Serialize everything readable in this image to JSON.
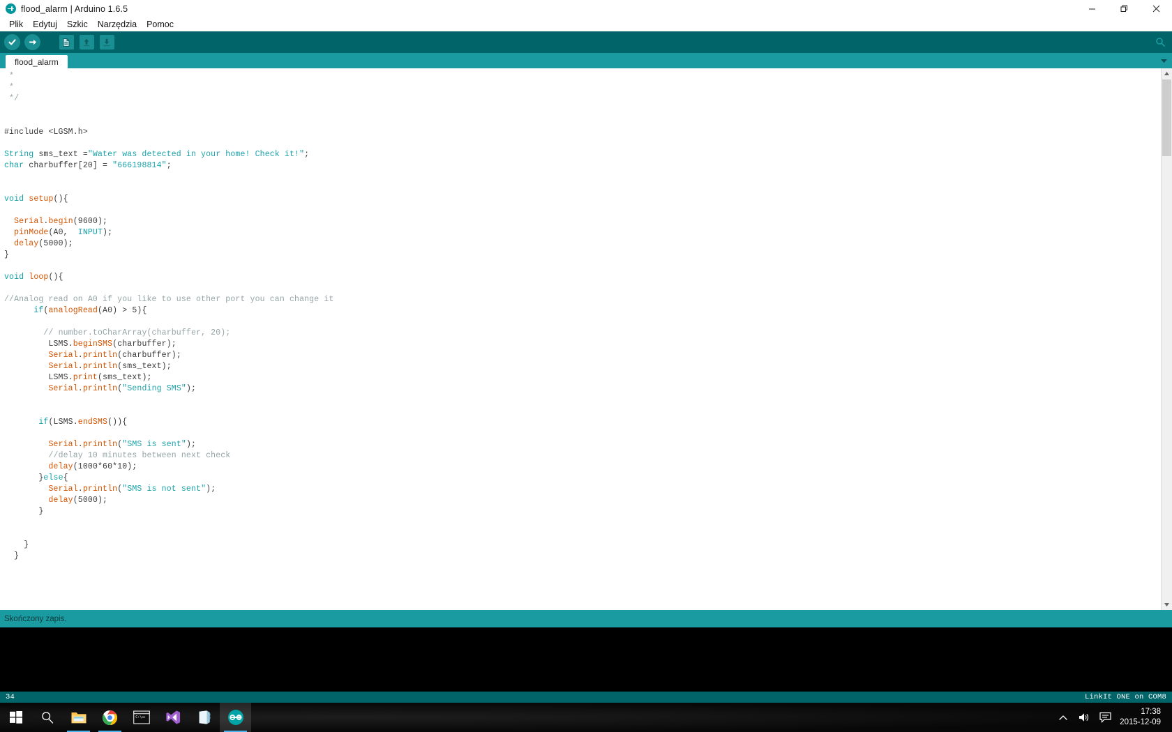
{
  "window": {
    "title": "flood_alarm | Arduino 1.6.5",
    "logo_icon": "arduino-logo-icon",
    "minimize_icon": "minimize-icon",
    "maximize_icon": "restore-icon",
    "close_icon": "close-icon"
  },
  "menubar": {
    "items": [
      {
        "label": "Plik"
      },
      {
        "label": "Edytuj"
      },
      {
        "label": "Szkic"
      },
      {
        "label": "Narzędzia"
      },
      {
        "label": "Pomoc"
      }
    ]
  },
  "toolbar": {
    "verify_icon": "check-icon",
    "upload_icon": "arrow-right-icon",
    "new_icon": "new-file-icon",
    "open_icon": "open-folder-up-arrow-icon",
    "save_icon": "save-down-arrow-icon",
    "serial_monitor_icon": "magnifier-icon"
  },
  "tabs": {
    "active": "flood_alarm",
    "items": [
      {
        "label": "flood_alarm"
      }
    ],
    "menu_icon": "chevron-down-icon"
  },
  "editor": {
    "lines": [
      [
        {
          "t": " *",
          "c": "cmt"
        }
      ],
      [
        {
          "t": " *",
          "c": "cmt"
        }
      ],
      [
        {
          "t": " */",
          "c": "cmt"
        }
      ],
      [
        {
          "t": "",
          "c": "plain"
        }
      ],
      [
        {
          "t": "",
          "c": "plain"
        }
      ],
      [
        {
          "t": "#include <LGSM.h>",
          "c": "plain"
        }
      ],
      [
        {
          "t": "",
          "c": "plain"
        }
      ],
      [
        {
          "t": "String",
          "c": "kw"
        },
        {
          "t": " sms_text =",
          "c": "plain"
        },
        {
          "t": "\"Water was detected in your home! Check it!\"",
          "c": "str"
        },
        {
          "t": ";",
          "c": "plain"
        }
      ],
      [
        {
          "t": "char",
          "c": "kw"
        },
        {
          "t": " charbuffer[20] = ",
          "c": "plain"
        },
        {
          "t": "\"666198814\"",
          "c": "str"
        },
        {
          "t": ";",
          "c": "plain"
        }
      ],
      [
        {
          "t": "",
          "c": "plain"
        }
      ],
      [
        {
          "t": "",
          "c": "plain"
        }
      ],
      [
        {
          "t": "void",
          "c": "kw"
        },
        {
          "t": " ",
          "c": "plain"
        },
        {
          "t": "setup",
          "c": "fn"
        },
        {
          "t": "(){",
          "c": "plain"
        }
      ],
      [
        {
          "t": "",
          "c": "plain"
        }
      ],
      [
        {
          "t": "  ",
          "c": "plain"
        },
        {
          "t": "Serial",
          "c": "fn"
        },
        {
          "t": ".",
          "c": "plain"
        },
        {
          "t": "begin",
          "c": "fn"
        },
        {
          "t": "(9600);",
          "c": "plain"
        }
      ],
      [
        {
          "t": "  ",
          "c": "plain"
        },
        {
          "t": "pinMode",
          "c": "fn"
        },
        {
          "t": "(A0,  ",
          "c": "plain"
        },
        {
          "t": "INPUT",
          "c": "kw"
        },
        {
          "t": ");",
          "c": "plain"
        }
      ],
      [
        {
          "t": "  ",
          "c": "plain"
        },
        {
          "t": "delay",
          "c": "fn"
        },
        {
          "t": "(5000);",
          "c": "plain"
        }
      ],
      [
        {
          "t": "}",
          "c": "plain"
        }
      ],
      [
        {
          "t": "",
          "c": "plain"
        }
      ],
      [
        {
          "t": "void",
          "c": "kw"
        },
        {
          "t": " ",
          "c": "plain"
        },
        {
          "t": "loop",
          "c": "fn"
        },
        {
          "t": "(){",
          "c": "plain"
        }
      ],
      [
        {
          "t": "",
          "c": "plain"
        }
      ],
      [
        {
          "t": "//Analog read on A0 if you like to use other port you can change it",
          "c": "cmt"
        }
      ],
      [
        {
          "t": "      ",
          "c": "plain"
        },
        {
          "t": "if",
          "c": "kw"
        },
        {
          "t": "(",
          "c": "plain"
        },
        {
          "t": "analogRead",
          "c": "fn"
        },
        {
          "t": "(A0) > 5){",
          "c": "plain"
        }
      ],
      [
        {
          "t": "",
          "c": "plain"
        }
      ],
      [
        {
          "t": "        ",
          "c": "plain"
        },
        {
          "t": "// number.toCharArray(charbuffer, 20);",
          "c": "cmt"
        }
      ],
      [
        {
          "t": "         LSMS.",
          "c": "plain"
        },
        {
          "t": "beginSMS",
          "c": "fn"
        },
        {
          "t": "(charbuffer);",
          "c": "plain"
        }
      ],
      [
        {
          "t": "         ",
          "c": "plain"
        },
        {
          "t": "Serial",
          "c": "fn"
        },
        {
          "t": ".",
          "c": "plain"
        },
        {
          "t": "println",
          "c": "fn"
        },
        {
          "t": "(charbuffer);",
          "c": "plain"
        }
      ],
      [
        {
          "t": "         ",
          "c": "plain"
        },
        {
          "t": "Serial",
          "c": "fn"
        },
        {
          "t": ".",
          "c": "plain"
        },
        {
          "t": "println",
          "c": "fn"
        },
        {
          "t": "(sms_text);",
          "c": "plain"
        }
      ],
      [
        {
          "t": "         LSMS.",
          "c": "plain"
        },
        {
          "t": "print",
          "c": "fn"
        },
        {
          "t": "(sms_text);",
          "c": "plain"
        }
      ],
      [
        {
          "t": "         ",
          "c": "plain"
        },
        {
          "t": "Serial",
          "c": "fn"
        },
        {
          "t": ".",
          "c": "plain"
        },
        {
          "t": "println",
          "c": "fn"
        },
        {
          "t": "(",
          "c": "plain"
        },
        {
          "t": "\"Sending SMS\"",
          "c": "str"
        },
        {
          "t": ");",
          "c": "plain"
        }
      ],
      [
        {
          "t": "",
          "c": "plain"
        }
      ],
      [
        {
          "t": "",
          "c": "plain"
        }
      ],
      [
        {
          "t": "       ",
          "c": "plain"
        },
        {
          "t": "if",
          "c": "kw"
        },
        {
          "t": "(LSMS.",
          "c": "plain"
        },
        {
          "t": "endSMS",
          "c": "fn"
        },
        {
          "t": "()){",
          "c": "plain"
        }
      ],
      [
        {
          "t": "",
          "c": "plain"
        }
      ],
      [
        {
          "t": "         ",
          "c": "plain"
        },
        {
          "t": "Serial",
          "c": "fn"
        },
        {
          "t": ".",
          "c": "plain"
        },
        {
          "t": "println",
          "c": "fn"
        },
        {
          "t": "(",
          "c": "plain"
        },
        {
          "t": "\"SMS is sent\"",
          "c": "str"
        },
        {
          "t": ");",
          "c": "plain"
        }
      ],
      [
        {
          "t": "         ",
          "c": "plain"
        },
        {
          "t": "//delay 10 minutes between next check",
          "c": "cmt"
        }
      ],
      [
        {
          "t": "         ",
          "c": "plain"
        },
        {
          "t": "delay",
          "c": "fn"
        },
        {
          "t": "(1000*60*10);",
          "c": "plain"
        }
      ],
      [
        {
          "t": "       }",
          "c": "plain"
        },
        {
          "t": "else",
          "c": "kw"
        },
        {
          "t": "{",
          "c": "plain"
        }
      ],
      [
        {
          "t": "         ",
          "c": "plain"
        },
        {
          "t": "Serial",
          "c": "fn"
        },
        {
          "t": ".",
          "c": "plain"
        },
        {
          "t": "println",
          "c": "fn"
        },
        {
          "t": "(",
          "c": "plain"
        },
        {
          "t": "\"SMS is not sent\"",
          "c": "str"
        },
        {
          "t": ");",
          "c": "plain"
        }
      ],
      [
        {
          "t": "         ",
          "c": "plain"
        },
        {
          "t": "delay",
          "c": "fn"
        },
        {
          "t": "(5000);",
          "c": "plain"
        }
      ],
      [
        {
          "t": "       }",
          "c": "plain"
        }
      ],
      [
        {
          "t": "",
          "c": "plain"
        }
      ],
      [
        {
          "t": "",
          "c": "plain"
        }
      ],
      [
        {
          "t": "    }",
          "c": "plain"
        }
      ],
      [
        {
          "t": "  }",
          "c": "plain"
        }
      ]
    ]
  },
  "status": {
    "message": "Skończony zapis.",
    "line_number": "34",
    "board": "LinkIt ONE on COM8"
  },
  "taskbar": {
    "items": [
      {
        "name": "start-button",
        "icon": "windows-logo-icon",
        "active": false,
        "running": false
      },
      {
        "name": "search-button",
        "icon": "search-icon",
        "active": false,
        "running": false
      },
      {
        "name": "file-explorer",
        "icon": "folder-icon",
        "active": false,
        "running": true
      },
      {
        "name": "google-chrome",
        "icon": "chrome-icon",
        "active": false,
        "running": true
      },
      {
        "name": "command-prompt",
        "icon": "terminal-icon",
        "active": false,
        "running": false
      },
      {
        "name": "visual-studio",
        "icon": "visual-studio-icon",
        "active": false,
        "running": false
      },
      {
        "name": "onenote",
        "icon": "onenote-icon",
        "active": false,
        "running": false
      },
      {
        "name": "arduino-ide",
        "icon": "arduino-logo-icon",
        "active": true,
        "running": true
      }
    ],
    "tray": {
      "show_hidden_icon": "chevron-up-icon",
      "volume_icon": "speaker-icon",
      "action_center_icon": "notification-icon",
      "time": "17:38",
      "date": "2015-12-09"
    }
  }
}
